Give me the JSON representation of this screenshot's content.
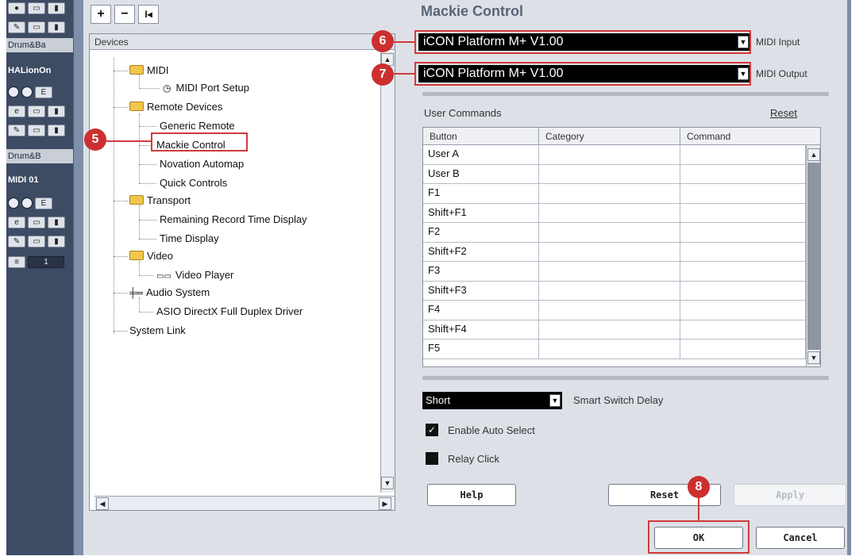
{
  "toolbar": {
    "add": "+",
    "remove": "−",
    "reset": "I◂"
  },
  "devices_panel": {
    "header": "Devices",
    "tree": [
      {
        "label": "MIDI",
        "type": "folder"
      },
      {
        "label": "MIDI Port Setup",
        "type": "item"
      },
      {
        "label": "Remote Devices",
        "type": "folder"
      },
      {
        "label": "Generic Remote",
        "type": "item"
      },
      {
        "label": "Mackie Control",
        "type": "item",
        "selected": true
      },
      {
        "label": "Novation Automap",
        "type": "item"
      },
      {
        "label": "Quick Controls",
        "type": "item"
      },
      {
        "label": "Transport",
        "type": "folder"
      },
      {
        "label": "Remaining Record Time Display",
        "type": "item"
      },
      {
        "label": "Time Display",
        "type": "item"
      },
      {
        "label": "Video",
        "type": "folder"
      },
      {
        "label": "Video Player",
        "type": "item"
      },
      {
        "label": "Audio System",
        "type": "item"
      },
      {
        "label": "ASIO DirectX Full Duplex Driver",
        "type": "item"
      },
      {
        "label": "System Link",
        "type": "item"
      }
    ]
  },
  "track_strip": {
    "track1": "Drum&Ba",
    "track2": "HALionOn",
    "track3": "Drum&B",
    "track4": "MIDI 01",
    "counter": "1"
  },
  "settings": {
    "title": "Mackie Control",
    "midi_input": {
      "value": "iCON Platform M+ V1.00",
      "label": "MIDI Input"
    },
    "midi_output": {
      "value": "iCON Platform M+ V1.00",
      "label": "MIDI Output"
    },
    "user_commands_label": "User Commands",
    "reset_link": "Reset",
    "table": {
      "headers": [
        "Button",
        "Category",
        "Command"
      ],
      "rows": [
        "User A",
        "User B",
        "F1",
        "Shift+F1",
        "F2",
        "Shift+F2",
        "F3",
        "Shift+F3",
        "F4",
        "Shift+F4",
        "F5"
      ]
    },
    "smart_switch": {
      "value": "Short",
      "label": "Smart Switch Delay"
    },
    "enable_auto_select": {
      "label": "Enable Auto Select",
      "checked": true
    },
    "relay_click": {
      "label": "Relay Click",
      "checked": false
    }
  },
  "buttons": {
    "help": "Help",
    "reset": "Reset",
    "apply": "Apply",
    "ok": "OK",
    "cancel": "Cancel"
  },
  "markers": {
    "m5": "5",
    "m6": "6",
    "m7": "7",
    "m8": "8"
  },
  "colors": {
    "annotation": "#d13a3a",
    "dialog": "#dde1e7",
    "strip": "#3d4b63"
  }
}
